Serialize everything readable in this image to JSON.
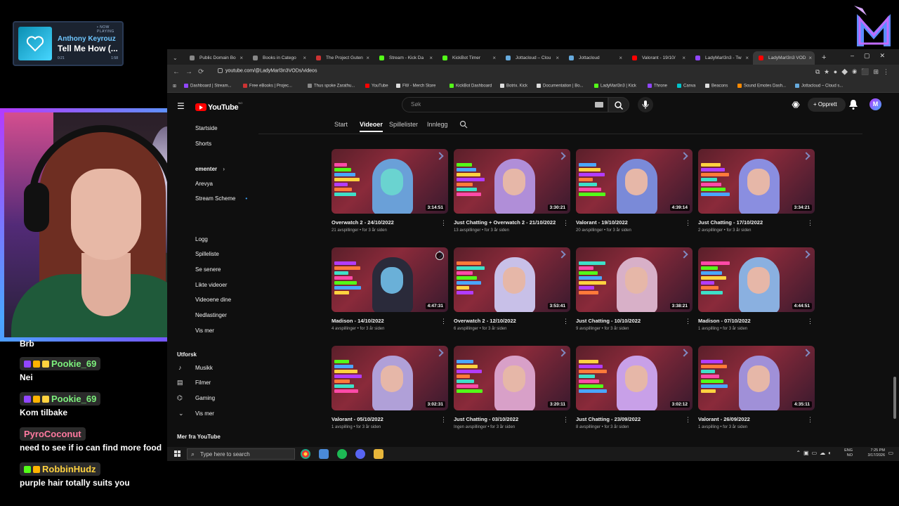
{
  "now_playing": {
    "tag": "• NOW PLAYING",
    "artist": "Anthony Keyrouz",
    "song": "Tell Me How (...",
    "elapsed": "0:21",
    "total": "1:58"
  },
  "chat": [
    {
      "type": "msg",
      "text": "Brb"
    },
    {
      "type": "user",
      "name": "Pookie_69",
      "color": "#7cf07c"
    },
    {
      "type": "msg",
      "text": "Nei"
    },
    {
      "type": "user",
      "name": "Pookie_69",
      "color": "#7cf07c"
    },
    {
      "type": "msg",
      "text": "Kom tilbake"
    },
    {
      "type": "user",
      "name": "PyroCoconut",
      "color": "#ff7aa0"
    },
    {
      "type": "msg",
      "text": "need to see if io can find more food"
    },
    {
      "type": "user",
      "name": "RobbinHudz",
      "color": "#ffd23f"
    },
    {
      "type": "msg",
      "text": "purple hair totally suits you"
    }
  ],
  "browser": {
    "tabs": [
      {
        "label": "Public Domain Bo",
        "color": "#888"
      },
      {
        "label": "Books in Catego",
        "color": "#888"
      },
      {
        "label": "The Project Guten",
        "color": "#c33"
      },
      {
        "label": "Stream - Kick Da",
        "color": "#53fc18"
      },
      {
        "label": "KickBot Timer",
        "color": "#53fc18"
      },
      {
        "label": "Jottacloud – Clou",
        "color": "#6ad"
      },
      {
        "label": "Jottacloud",
        "color": "#6ad"
      },
      {
        "label": "Valorant - 19/10/",
        "color": "#f00"
      },
      {
        "label": "LadyMarl3n3 - Tw",
        "color": "#9146ff"
      },
      {
        "label": "LadyMarl3n3 VOD",
        "color": "#f00",
        "active": true
      }
    ],
    "url": "youtube.com/@LadyMarl3n3VODs/videos",
    "bookmarks": [
      {
        "label": "Dashboard | Stream...",
        "color": "#9146ff"
      },
      {
        "label": "Free eBooks | Projec...",
        "color": "#c33"
      },
      {
        "label": "Thus spoke Zarathu...",
        "color": "#888"
      },
      {
        "label": "YouTube",
        "color": "#f00"
      },
      {
        "label": "FW - Merch Store",
        "color": "#ddd"
      },
      {
        "label": "KickBot Dashboard",
        "color": "#53fc18"
      },
      {
        "label": "Botrix. Kick",
        "color": "#ddd"
      },
      {
        "label": "Documentation | Bo...",
        "color": "#ddd"
      },
      {
        "label": "LadyMarl3n3 | Kick",
        "color": "#53fc18"
      },
      {
        "label": "Throne",
        "color": "#9146ff"
      },
      {
        "label": "Canva",
        "color": "#00c4cc"
      },
      {
        "label": "Beacons",
        "color": "#ddd"
      },
      {
        "label": "Sound Emotes Dash...",
        "color": "#ff8a00"
      },
      {
        "label": "Jottacloud – Cloud s...",
        "color": "#6ad"
      }
    ]
  },
  "youtube": {
    "logo_text": "YouTube",
    "logo_region": "NO",
    "search_placeholder": "Søk",
    "create_label": "+ Opprett",
    "avatar_letter": "M",
    "sidebar": [
      {
        "label": "Startside",
        "icon": "home-icon"
      },
      {
        "label": "Shorts",
        "icon": "shorts-icon"
      },
      {
        "label": "ementer",
        "icon": "subscriptions-icon",
        "heading": true
      },
      {
        "label": "Arevya",
        "icon": "channel-icon"
      },
      {
        "label": "Stream Scheme",
        "icon": "channel-icon",
        "dot": true
      },
      {
        "label": "Logg",
        "icon": "history-icon"
      },
      {
        "label": "Spilleliste",
        "icon": "playlist-icon"
      },
      {
        "label": "Se senere",
        "icon": "clock-icon"
      },
      {
        "label": "Likte videoer",
        "icon": "like-icon"
      },
      {
        "label": "Videoene dine",
        "icon": "video-icon"
      },
      {
        "label": "Nedlastinger",
        "icon": "download-icon"
      },
      {
        "label": "Vis mer",
        "icon": "chevron-down-icon"
      }
    ],
    "explore": {
      "heading": "Utforsk",
      "items": [
        {
          "label": "Musikk",
          "icon": "music-icon"
        },
        {
          "label": "Filmer",
          "icon": "film-icon"
        },
        {
          "label": "Gaming",
          "icon": "gaming-icon"
        },
        {
          "label": "Vis mer",
          "icon": "chevron-down-icon"
        }
      ],
      "more": "Mer fra YouTube"
    },
    "channel_tabs": [
      "Start",
      "Videoer",
      "Spillelister",
      "Innlegg"
    ],
    "active_tab": "Videoer",
    "videos": [
      {
        "title": "Overwatch 2 - 24/10/2022",
        "meta": "21 avspillinger • for 3 år siden",
        "duration": "3:14:51",
        "hair": "#6aa0d8",
        "face": "#6ad3d0"
      },
      {
        "title": "Just Chatting + Overwatch 2 - 21/10/2022",
        "meta": "13 avspillinger • for 3 år siden",
        "duration": "3:30:21",
        "hair": "#b08ed8",
        "face": "#e6b7a8"
      },
      {
        "title": "Valorant - 19/10/2022",
        "meta": "20 avspillinger • for 3 år siden",
        "duration": "4:39:14",
        "hair": "#7a8ad8",
        "face": "#e6b7a8"
      },
      {
        "title": "Just Chatting - 17/10/2022",
        "meta": "2 avspillinger • for 3 år siden",
        "duration": "3:34:21",
        "hair": "#8a8ee0",
        "face": "#e6b7a8"
      },
      {
        "title": "Madison - 14/10/2022",
        "meta": "4 avspillinger • for 3 år siden",
        "duration": "4:47:31",
        "hair": "#2a2a3a",
        "face": "#6ab0d8"
      },
      {
        "title": "Overwatch 2 - 12/10/2022",
        "meta": "6 avspillinger • for 3 år siden",
        "duration": "3:53:41",
        "hair": "#c8c0e8",
        "face": "#e6b7a8"
      },
      {
        "title": "Just Chatting - 10/10/2022",
        "meta": "9 avspillinger • for 3 år siden",
        "duration": "3:38:21",
        "hair": "#d8b0c8",
        "face": "#e6b7a8"
      },
      {
        "title": "Madison - 07/10/2022",
        "meta": "1 avspilling • for 3 år siden",
        "duration": "4:44:51",
        "hair": "#8ab0e0",
        "face": "#e6b7a8"
      },
      {
        "title": "Valorant - 05/10/2022",
        "meta": "1 avspilling • for 3 år siden",
        "duration": "3:02:31",
        "hair": "#b0a0d8",
        "face": "#e6b7a8"
      },
      {
        "title": "Just Chatting - 03/10/2022",
        "meta": "Ingen avspillinger • for 3 år siden",
        "duration": "3:20:11",
        "hair": "#d8a0c8",
        "face": "#e6b7a8"
      },
      {
        "title": "Just Chatting - 23/09/2022",
        "meta": "8 avspillinger • for 3 år siden",
        "duration": "3:02:12",
        "hair": "#c8a0e8",
        "face": "#e6b7a8"
      },
      {
        "title": "Valorant - 26/09/2022",
        "meta": "1 avspilling • for 3 år siden",
        "duration": "4:35:11",
        "hair": "#a090d8",
        "face": "#e6b7a8"
      }
    ]
  },
  "taskbar": {
    "search_placeholder": "Type here to search",
    "lang": "ENG",
    "region": "NO",
    "time": "7:25 PM",
    "date": "3/17/2026"
  }
}
